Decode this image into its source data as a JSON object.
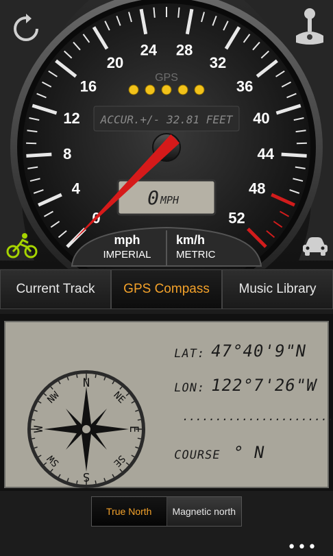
{
  "gauge": {
    "gps_label": "GPS",
    "accuracy_text": "ACCUR.+/- 32.81 FEET",
    "speed_value": "0",
    "speed_unit": "MPH",
    "scale_labels": [
      "0",
      "4",
      "8",
      "12",
      "16",
      "20",
      "24",
      "28",
      "32",
      "36",
      "40",
      "44",
      "48",
      "52"
    ],
    "max_speed": 52,
    "current_speed": 0,
    "gps_signal_dots": 5
  },
  "units": {
    "imperial_unit": "mph",
    "imperial_label": "IMPERIAL",
    "metric_unit": "km/h",
    "metric_label": "METRIC"
  },
  "tabs": [
    {
      "label": "Current Track",
      "active": false
    },
    {
      "label": "GPS Compass",
      "active": true
    },
    {
      "label": "Music Library",
      "active": false
    }
  ],
  "position": {
    "lat_label": "LAT:",
    "lat_value": "47°40'9\"N",
    "lon_label": "LON:",
    "lon_value": "122°7'26\"W",
    "separator": "..........................",
    "course_label": "COURSE",
    "course_value": "° N"
  },
  "compass": {
    "n": "N",
    "ne": "NE",
    "e": "E",
    "se": "SE",
    "s": "S",
    "sw": "SW",
    "w": "W",
    "nw": "NW"
  },
  "north_toggle": {
    "true_north": "True North",
    "magnetic_north": "Magnetic north",
    "selected": "true_north"
  },
  "app_bar": {
    "more": "•••"
  },
  "colors": {
    "accent": "#f4a22a",
    "needle": "#d61a1a",
    "gps_dot": "#f2c21a",
    "bike_icon": "#a6d400",
    "lcd": "#a9a69b"
  },
  "icons": [
    "refresh-icon",
    "joystick-icon",
    "bicycle-icon",
    "car-icon"
  ]
}
